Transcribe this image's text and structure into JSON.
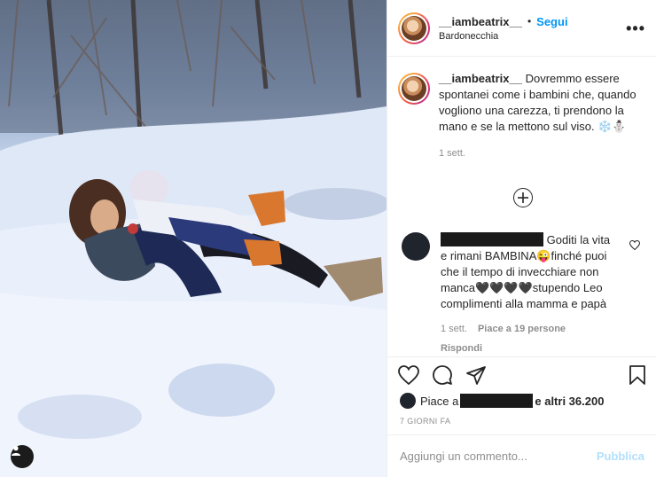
{
  "post": {
    "username": "__iambeatrix__",
    "follow_label": "Segui",
    "separator": "•",
    "location": "Bardonecchia",
    "more_icon": "more-horizontal-icon",
    "caption": {
      "username": "__iambeatrix__",
      "text": "Dovremmo essere spontanei come i bambini che, quando vogliono una carezza, ti prendono la mano e se la mettono sul viso. ❄️⛄",
      "time": "1 sett."
    },
    "load_more_icon": "plus-circle-icon",
    "comment": {
      "text": "Goditi la vita e rimani BAMBINA😜finché puoi che il tempo di invecchiare non manca🖤🖤🖤🖤stupendo Leo complimenti alla mamma e papà",
      "time": "1 sett.",
      "likes": "Piace a 19 persone",
      "reply": "Rispondi"
    },
    "likes_prefix": "Piace a",
    "likes_suffix": "e altri 36.200",
    "date": "7 GIORNI FA",
    "add_comment_placeholder": "Aggiungi un commento...",
    "publish_label": "Pubblica"
  },
  "colors": {
    "accent": "#0095f6",
    "publish_disabled": "#b2dffc",
    "muted": "#8e8e8e",
    "text": "#262626"
  }
}
